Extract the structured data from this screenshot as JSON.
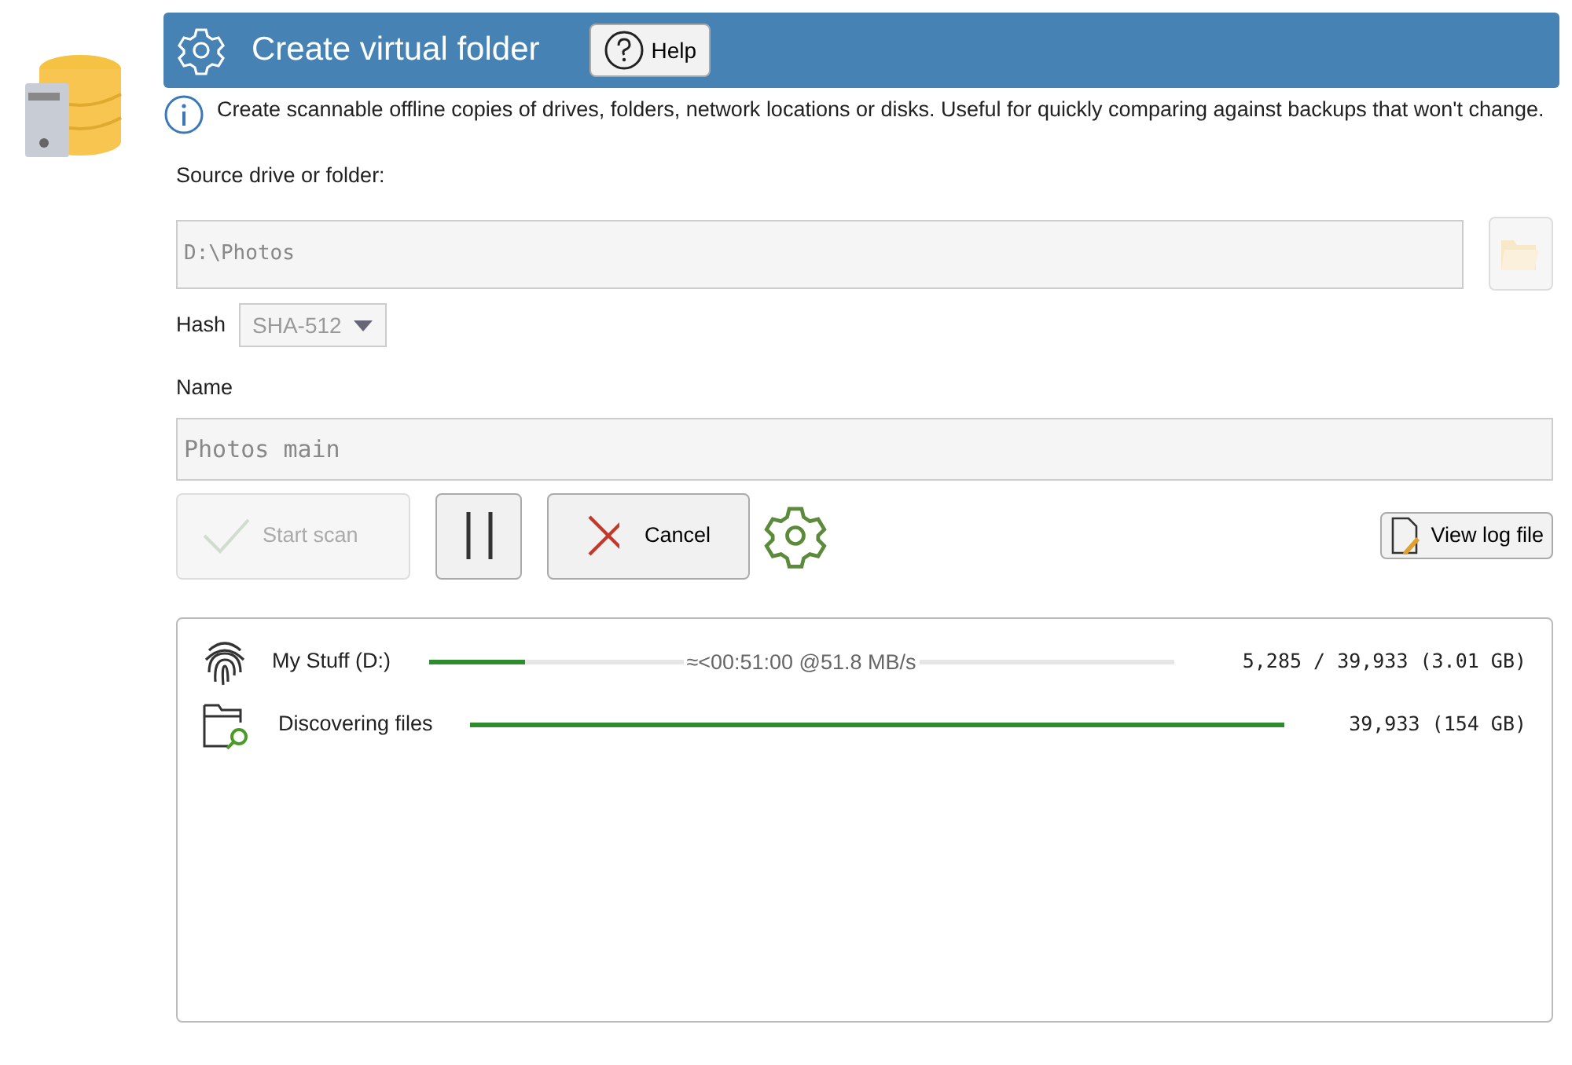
{
  "header": {
    "title": "Create virtual folder",
    "help_button": "Help"
  },
  "info": "Create scannable offline copies of drives, folders, network locations or disks. Useful for quickly comparing against backups that won't change.",
  "source": {
    "label": "Source drive or folder:",
    "value": "D:\\Photos",
    "disabled": true
  },
  "hash": {
    "label": "Hash",
    "value": "SHA-512",
    "disabled": true
  },
  "name": {
    "label": "Name",
    "value": "Photos main",
    "disabled": true
  },
  "buttons": {
    "start": {
      "label": "Start scan",
      "disabled": true
    },
    "cancel": {
      "label": "Cancel",
      "disabled": false
    },
    "view_log": {
      "label": "View log file"
    }
  },
  "progress": [
    {
      "kind": "hashing",
      "label": "My Stuff (D:)",
      "level": 0.13,
      "eta": "≈<00:51:00 @51.8 MB/s",
      "count": "5,285 / 39,933 (3.01 GB)"
    },
    {
      "kind": "discovering",
      "label": "Discovering files",
      "level": 1,
      "count": "39,933 (154 GB)"
    }
  ]
}
